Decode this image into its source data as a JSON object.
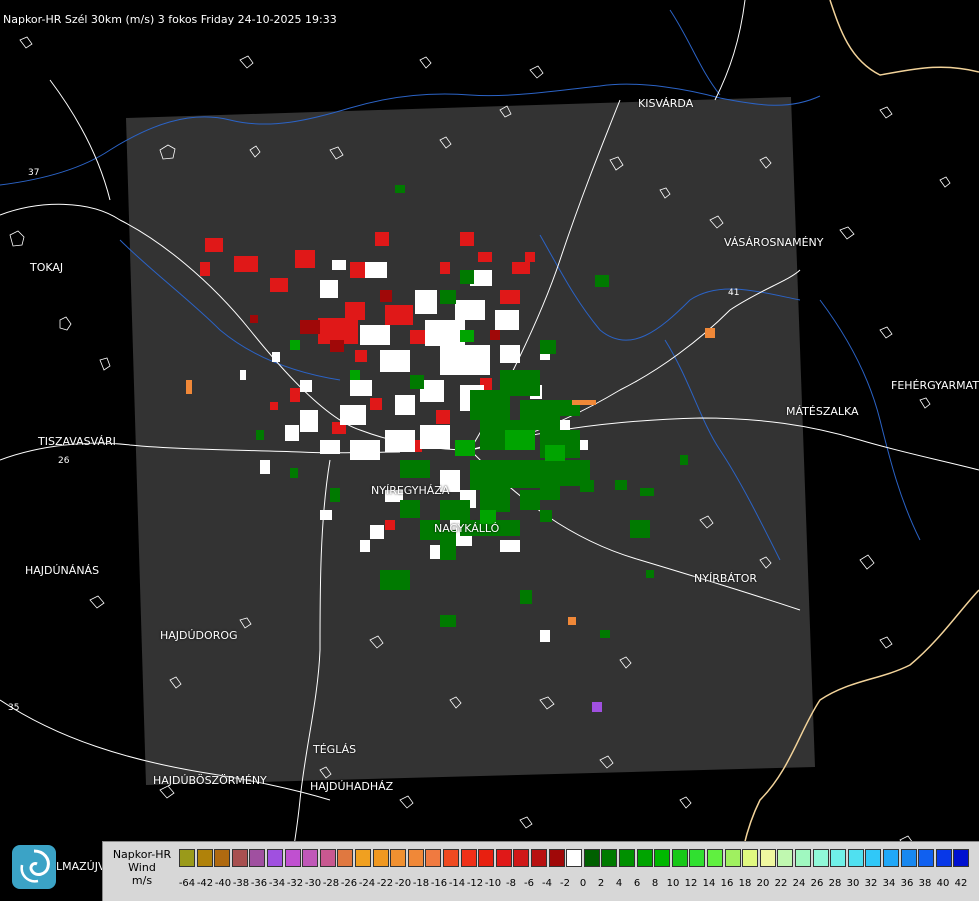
{
  "title": "Napkor-HR Szél 30km (m/s) 3 fokos Friday 24-10-2025 19:33",
  "cities": [
    {
      "name": "KISVÁRDA"
    },
    {
      "name": "VÁSÁROSNAMÉNY"
    },
    {
      "name": "TOKAJ"
    },
    {
      "name": "FEHÉRGYARMAT"
    },
    {
      "name": "MÁTÉSZALKA"
    },
    {
      "name": "TISZAVASVÁRI"
    },
    {
      "name": "NYÍREGYHÁZA"
    },
    {
      "name": "NAGYKÁLLÓ"
    },
    {
      "name": "NYÍRBÁTOR"
    },
    {
      "name": "HAJDÚNÁNÁS"
    },
    {
      "name": "HAJDÚDOROG"
    },
    {
      "name": "TÉGLÁS"
    },
    {
      "name": "HAJDÚBÖSZÖRMÉNY"
    },
    {
      "name": "HAJDÚHADHÁZ"
    }
  ],
  "road_numbers": [
    "37",
    "26",
    "41",
    "35"
  ],
  "logo_text": "LMAZÚJVÁR",
  "legend": {
    "title_line1": "Napkor-HR",
    "title_line2": "Wind",
    "title_line3": "m/s",
    "swatches": [
      {
        "value": -64,
        "color": "#9a9a1a"
      },
      {
        "value": -42,
        "color": "#b0820a"
      },
      {
        "value": -40,
        "color": "#b06a10"
      },
      {
        "value": -38,
        "color": "#a85050"
      },
      {
        "value": -36,
        "color": "#a050a0"
      },
      {
        "value": -34,
        "color": "#a050e0"
      },
      {
        "value": -32,
        "color": "#c050d0"
      },
      {
        "value": -30,
        "color": "#c058b8"
      },
      {
        "value": -28,
        "color": "#c85890"
      },
      {
        "value": -26,
        "color": "#e07840"
      },
      {
        "value": -24,
        "color": "#f0a020"
      },
      {
        "value": -22,
        "color": "#f09820"
      },
      {
        "value": -20,
        "color": "#f09030"
      },
      {
        "value": -18,
        "color": "#f08838"
      },
      {
        "value": -16,
        "color": "#f07a40"
      },
      {
        "value": -14,
        "color": "#f04a20"
      },
      {
        "value": -12,
        "color": "#f03018"
      },
      {
        "value": -10,
        "color": "#e82010"
      },
      {
        "value": -8,
        "color": "#e01818"
      },
      {
        "value": -6,
        "color": "#d01818"
      },
      {
        "value": -4,
        "color": "#b81010"
      },
      {
        "value": -2,
        "color": "#a00808"
      },
      {
        "value": 0,
        "color": "#ffffff"
      },
      {
        "value": 0.1,
        "color": "#006000"
      },
      {
        "value": 2,
        "color": "#007a00"
      },
      {
        "value": 4,
        "color": "#009000"
      },
      {
        "value": 6,
        "color": "#00a400"
      },
      {
        "value": 8,
        "color": "#00b800"
      },
      {
        "value": 10,
        "color": "#18c818"
      },
      {
        "value": 12,
        "color": "#30e030"
      },
      {
        "value": 14,
        "color": "#60f040"
      },
      {
        "value": 16,
        "color": "#a0f060"
      },
      {
        "value": 18,
        "color": "#e0f880"
      },
      {
        "value": 20,
        "color": "#f0f8a0"
      },
      {
        "value": 22,
        "color": "#c0f8b0"
      },
      {
        "value": 24,
        "color": "#a0f8c0"
      },
      {
        "value": 26,
        "color": "#90f8d8"
      },
      {
        "value": 28,
        "color": "#70f0e8"
      },
      {
        "value": 30,
        "color": "#50e0f0"
      },
      {
        "value": 32,
        "color": "#30c8f8"
      },
      {
        "value": 34,
        "color": "#20a8f8"
      },
      {
        "value": 36,
        "color": "#1888f0"
      },
      {
        "value": 38,
        "color": "#1060f0"
      },
      {
        "value": 40,
        "color": "#0838e8"
      },
      {
        "value": 42,
        "color": "#0010d0"
      }
    ],
    "tick_labels": [
      "-64",
      "-42",
      "-40",
      "-38",
      "-36",
      "-34",
      "-32",
      "-30",
      "-28",
      "-26",
      "-24",
      "-22",
      "-20",
      "-18",
      "-16",
      "-14",
      "-12",
      "-10",
      "-8",
      "-6",
      "-4",
      "-2",
      "0",
      "2",
      "4",
      "6",
      "8",
      "10",
      "12",
      "14",
      "16",
      "18",
      "20",
      "22",
      "24",
      "26",
      "28",
      "30",
      "32",
      "34",
      "36",
      "38",
      "40",
      "42"
    ]
  }
}
